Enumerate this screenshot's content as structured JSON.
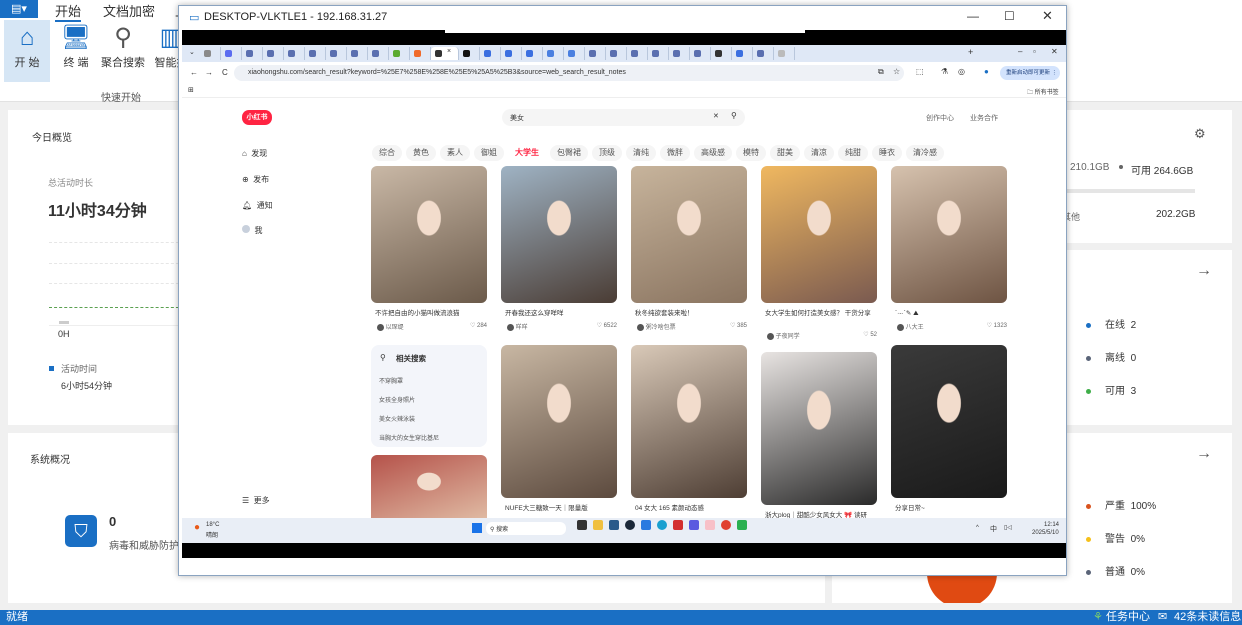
{
  "app": {
    "menu_tabs": [
      "开始",
      "文档加密",
      "上"
    ],
    "ribbon_buttons": [
      {
        "label": "开 始",
        "icon": "home-icon"
      },
      {
        "label": "终 端",
        "icon": "terminal-icon"
      },
      {
        "label": "聚合搜索",
        "icon": "search-icon"
      },
      {
        "label": "智能报",
        "icon": "report-icon"
      }
    ],
    "group_label": "快速开始"
  },
  "overview": {
    "title": "今日概览",
    "total_label": "总活动时长",
    "total_value": "11小时34分钟",
    "axis_label": "0H",
    "legend_label": "活动时间",
    "legend_value": "6小时54分钟"
  },
  "disk": {
    "used_partial": "210.1GB",
    "available": "可用 264.6GB",
    "other_label": "其他",
    "other_value": "202.2GB"
  },
  "terminals": {
    "items": [
      {
        "label": "在线",
        "value": "2",
        "color": "#1a6fc4"
      },
      {
        "label": "离线",
        "value": "0",
        "color": "#5a6478"
      },
      {
        "label": "可用",
        "value": "3",
        "color": "#3fae49"
      }
    ]
  },
  "alerts": {
    "items": [
      {
        "label": "严重",
        "value": "100%",
        "color": "#d9531e"
      },
      {
        "label": "警告",
        "value": "0%",
        "color": "#f5c01a"
      },
      {
        "label": "普通",
        "value": "0%",
        "color": "#5a6478"
      }
    ]
  },
  "system": {
    "title": "系统概况",
    "count": "0",
    "label": "病毒和威胁防护"
  },
  "status": {
    "left": "就绪",
    "tasks": "任务中心",
    "messages": "42条未读信息"
  },
  "remote": {
    "title": "DESKTOP-VLKTLE1 - 192.168.31.27",
    "tabs": [
      "#8a8a8a",
      "#5b6cf0",
      "#5a6fb0",
      "#5a6fb0",
      "#5a6fb0",
      "#5a6fb0",
      "#5a6fb0",
      "#5a6fb0",
      "#5a6fb0",
      "#5aaa30",
      "#f06a2a",
      "#333",
      "#111",
      "#3b6fe0",
      "#3b6fe0",
      "#3b6fe0",
      "#4a7fe0",
      "#4a7fe0",
      "#5a6fb0",
      "#5a6fb0",
      "#5a6fb0",
      "#5a6fb0",
      "#5a6fb0",
      "#5a6fb0",
      "#333",
      "#3b6fe0",
      "#5a6fb0",
      "#bbb"
    ],
    "url": "xiaohongshu.com/search_result?keyword=%25E7%258E%258E%25E5%25A5%25B3&source=web_search_result_notes",
    "update_btn": "重新启动即可更新",
    "bookmarks": "所有书签",
    "site": {
      "logo": "小红书",
      "search_value": "美女",
      "header_links": [
        "创作中心",
        "业务合作"
      ],
      "nav": [
        "发现",
        "发布",
        "通知",
        "我"
      ],
      "more": "更多",
      "chips": [
        "综合",
        "黄色",
        "素人",
        "御姐",
        "大学生",
        "包臀裙",
        "顶级",
        "清纯",
        "微胖",
        "高级感",
        "模特",
        "甜美",
        "清凉",
        "纯甜",
        "睡衣",
        "清冷感"
      ],
      "active_chip": "大学生",
      "related": {
        "title": "相关搜索",
        "items": [
          "不穿胸罩",
          "女孩全身照片",
          "美女火辣泳装",
          "当胸大的女生穿比基尼"
        ]
      },
      "notes": [
        {
          "title": "不许把自由的小猫叫做流浪猫",
          "author": "以琛缇",
          "likes": "284",
          "colors": [
            "#c9b8a6",
            "#6b5a4a"
          ]
        },
        {
          "title": "开春我还这么穿咩咩",
          "author": "咩咩",
          "likes": "6522",
          "colors": [
            "#9fb3c4",
            "#4a3c34"
          ]
        },
        {
          "title": "秋冬纯欲套装来啦！",
          "author": "粥冷啥包票",
          "likes": "385",
          "colors": [
            "#c7b49c",
            "#8a7460"
          ]
        },
        {
          "title": "女大学生如何打造美女感？ 干货分享",
          "author": "子夜同学",
          "likes": "52",
          "colors": [
            "#f0b860",
            "#7a5a50"
          ]
        },
        {
          "title": "`·-·`✎ ⛰",
          "author": "八大王",
          "likes": "1323",
          "colors": [
            "#d6c2ae",
            "#6e5443"
          ]
        },
        {
          "title": "NUFE大三糖致一天｜限量版",
          "author": "",
          "likes": "",
          "colors": [
            "#c8b7a3",
            "#5c4a3e"
          ]
        },
        {
          "title": "04 女大 165 素颜动态感",
          "author": "",
          "likes": "",
          "colors": [
            "#d9c9b8",
            "#4e3e34"
          ]
        },
        {
          "title": "浙大plog｜甜酷少女风女大 🎀 读研",
          "author": "",
          "likes": "",
          "colors": [
            "#e8e4e2",
            "#2a2a2a"
          ]
        },
        {
          "title": "分享日常~",
          "author": "",
          "likes": "",
          "colors": [
            "#3a3a3a",
            "#1a1a1a"
          ]
        },
        {
          "title": "",
          "author": "",
          "likes": "",
          "colors": [
            "#b5524a",
            "#e2c0a8"
          ]
        }
      ]
    },
    "taskbar": {
      "temp": "18°C",
      "weather": "晴朗",
      "search": "搜索",
      "ime": "中",
      "time": "12:14",
      "date": "2025/5/10"
    }
  }
}
